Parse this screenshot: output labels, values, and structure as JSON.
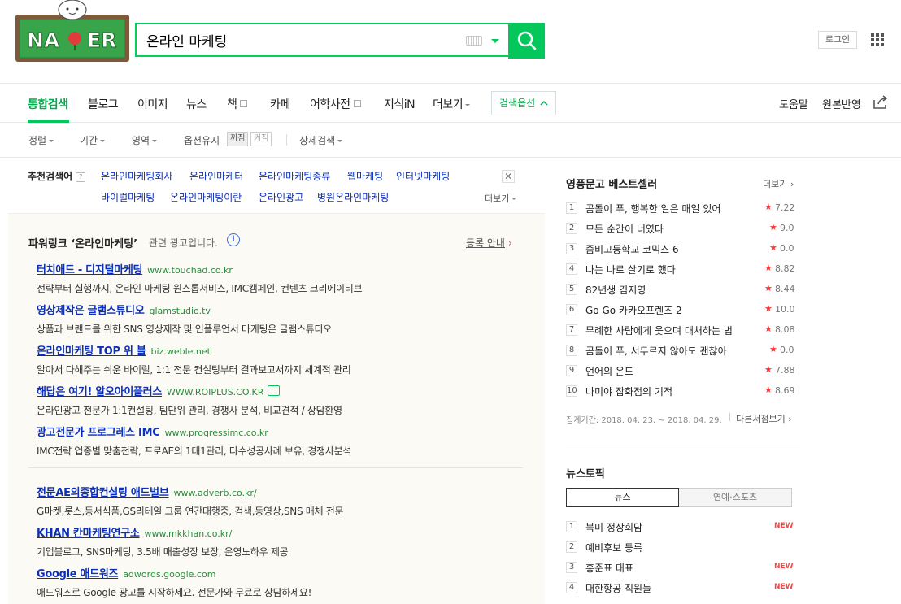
{
  "header": {
    "logo_text": "NAVER",
    "search_value": "온라인 마케팅",
    "login_label": "로그인"
  },
  "tabs": {
    "items": [
      {
        "label": "통합검색",
        "active": true
      },
      {
        "label": "블로그"
      },
      {
        "label": "이미지"
      },
      {
        "label": "뉴스"
      },
      {
        "label": "책"
      },
      {
        "label": "카페"
      },
      {
        "label": "어학사전"
      },
      {
        "label": "지식iN"
      },
      {
        "label": "더보기"
      }
    ],
    "options_label": "검색옵션",
    "help_label": "도움말",
    "feedback_label": "원본반영"
  },
  "filters": {
    "sort": "정렬",
    "period": "기간",
    "area": "영역",
    "option_keep": "옵션유지",
    "off": "꺼짐",
    "on": "켜짐",
    "detail": "상세검색"
  },
  "related": {
    "label": "추천검색어",
    "qmark": "?",
    "row1": [
      "온라인마케팅회사",
      "온라인마케터",
      "온라인마케팅종류",
      "웹마케팅",
      "인터넷마케팅"
    ],
    "row2": [
      "바이럴마케팅",
      "온라인마케팅이란",
      "온라인광고",
      "병원온라인마케팅"
    ],
    "more": "더보기"
  },
  "powerlink": {
    "title": "파워링크 ‘온라인마케팅’",
    "subtitle": "관련 광고입니다.",
    "info": "i",
    "register": "등록 안내",
    "ads": [
      {
        "title": "터치애드 - 디지털마케팅",
        "url": "www.touchad.co.kr",
        "desc": "전략부터 실행까지, 온라인 마케팅 원스톱서비스, IMC캠페인, 컨텐츠 크리에이티브"
      },
      {
        "title": "영상제작은 글램스튜디오",
        "url": "glamstudio.tv",
        "desc": "상품과 브랜드를 위한 SNS 영상제작 및 인플루언서 마케팅은 글램스튜디오"
      },
      {
        "title": "온라인마케팅 TOP 위 블",
        "url": "biz.weble.net",
        "desc": "알아서 다해주는 쉬운 바이럴, 1:1 전문 컨설팅부터 결과보고서까지 체계적 관리"
      },
      {
        "title": "해답은 여기! 알오아이플러스",
        "url": "WWW.ROIPLUS.CO.KR",
        "desc": "온라인광고 전문가 1:1컨설팅, 팀단위 관리, 경쟁사 분석, 비교견적 / 상담환영"
      },
      {
        "title": "광고전문가 프로그레스 IMC",
        "url": "www.progressimc.co.kr",
        "desc": "IMC전략 업종별 맞춤전략, 프로AE의 1대1관리, 다수성공사례 보유, 경쟁사분석"
      },
      {
        "title": "전문AE의종합컨설팅 애드벌브",
        "url": "www.adverb.co.kr/",
        "desc": "G마켓,롯스,동서식품,GS리테일 그룹 연간대행중, 검색,동영상,SNS 매체 전문"
      },
      {
        "title": "KHAN 칸마케팅연구소",
        "url": "www.mkkhan.co.kr/",
        "desc": "기업블로그, SNS마케팅, 3.5배 매출성장 보장, 운영노하우 제공"
      },
      {
        "title": "Google 애드워즈",
        "url": "adwords.google.com",
        "desc": "애드워즈로 Google 광고를 시작하세요. 전문가와 무료로 상담하세요!"
      }
    ]
  },
  "bestseller": {
    "title": "영풍문고 베스트셀러",
    "more": "더보기",
    "items": [
      {
        "rank": "1",
        "title": "곰돌이 푸, 행복한 일은 매일 있어",
        "score": "7.22"
      },
      {
        "rank": "2",
        "title": "모든 순간이 너였다",
        "score": "9.0"
      },
      {
        "rank": "3",
        "title": "좀비고등학교 코믹스 6",
        "score": "0.0"
      },
      {
        "rank": "4",
        "title": "나는 나로 살기로 했다",
        "score": "8.82"
      },
      {
        "rank": "5",
        "title": "82년생 김지영",
        "score": "8.44"
      },
      {
        "rank": "6",
        "title": "Go Go 카카오프렌즈 2",
        "score": "10.0"
      },
      {
        "rank": "7",
        "title": "무례한 사람에게 웃으며 대처하는 법",
        "score": "8.08"
      },
      {
        "rank": "8",
        "title": "곰돌이 푸, 서두르지 않아도 괜찮아",
        "score": "0.0"
      },
      {
        "rank": "9",
        "title": "언어의 온도",
        "score": "7.88"
      },
      {
        "rank": "10",
        "title": "나미야 잡화점의 기적",
        "score": "8.69"
      }
    ],
    "period": "집계기간: 2018. 04. 23. ~ 2018. 04. 29.",
    "other_store": "다른서점보기"
  },
  "news_topic": {
    "title": "뉴스토픽",
    "tabs": [
      "뉴스",
      "연예·스포츠"
    ],
    "items": [
      {
        "rank": "1",
        "title": "북미 정상회담",
        "badge": "NEW"
      },
      {
        "rank": "2",
        "title": "예비후보 등록",
        "badge": ""
      },
      {
        "rank": "3",
        "title": "홍준표 대표",
        "badge": "NEW"
      },
      {
        "rank": "4",
        "title": "대한항공 직원들",
        "badge": "NEW"
      }
    ]
  },
  "colors": {
    "brand": "#03c75a",
    "link": "#0c2fb8",
    "url": "#2c8a3d"
  }
}
